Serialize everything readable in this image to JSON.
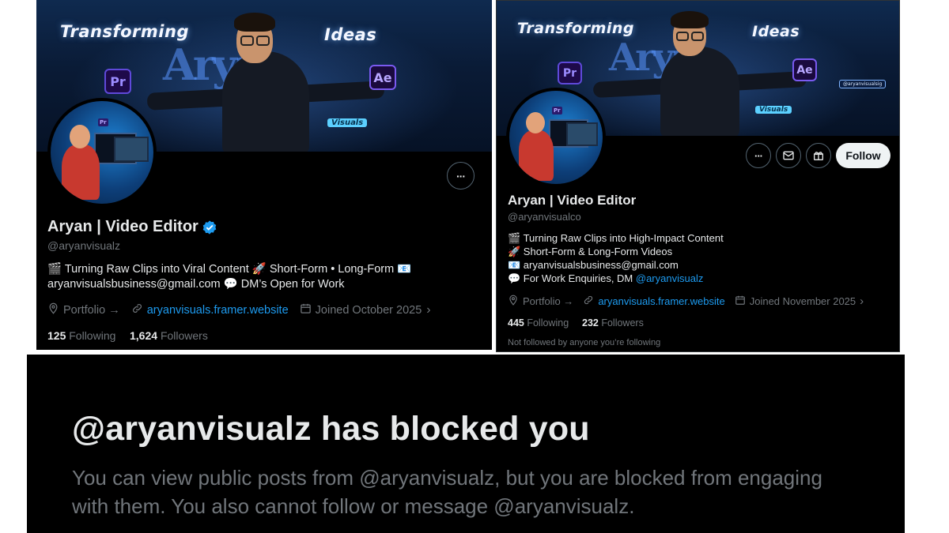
{
  "left_profile": {
    "banner": {
      "headline_left": "Transforming",
      "headline_right": "Ideas",
      "ghost_text": "Aryan",
      "pr_badge": "Pr",
      "ae_badge": "Ae",
      "tag": "Visuals"
    },
    "more_button_label": "···",
    "name": "Aryan | Video Editor",
    "handle": "@aryanvisualz",
    "bio_line1": "🎬 Turning Raw Clips into Viral Content 🚀 Short-Form • Long-Form 📧",
    "bio_line2": "aryanvisualsbusiness@gmail.com 💬 DM’s Open for Work",
    "portfolio_label": "Portfolio →",
    "website": "aryanvisuals.framer.website",
    "joined": "Joined October 2025",
    "following_count": "125",
    "following_label": "Following",
    "followers_count": "1,624",
    "followers_label": "Followers"
  },
  "right_profile": {
    "banner": {
      "headline_left": "Transforming",
      "headline_right": "Ideas",
      "ghost_text": "Aryan",
      "pr_badge": "Pr",
      "ae_badge": "Ae",
      "tag": "Visuals",
      "insta": "@aryanvisualsig"
    },
    "more_button_label": "···",
    "follow_button": "Follow",
    "name": "Aryan | Video Editor",
    "handle": "@aryanvisualco",
    "bio_line1": "🎬 Turning Raw Clips into High-Impact Content",
    "bio_line2": "🚀 Short-Form & Long-Form Videos",
    "bio_line3": "📧 aryanvisualsbusiness@gmail.com",
    "bio_line4_prefix": "💬 For Work Enquiries, DM ",
    "bio_line4_mention": "@aryanvisualz",
    "portfolio_label": "Portfolio →",
    "website": "aryanvisuals.framer.website",
    "joined": "Joined November 2025",
    "following_count": "445",
    "following_label": "Following",
    "followers_count": "232",
    "followers_label": "Followers",
    "not_followed_note": "Not followed by anyone you’re following"
  },
  "blocked_notice": {
    "title": "@aryanvisualz has blocked you",
    "body": "You can view public posts from @aryanvisualz, but you are blocked from engaging with them. You also cannot follow or message @aryanvisualz."
  },
  "colors": {
    "background": "#000000",
    "primary_text": "#e7e9ea",
    "secondary_text": "#71767b",
    "link": "#1d9bf0",
    "verified": "#1d9bf0"
  }
}
